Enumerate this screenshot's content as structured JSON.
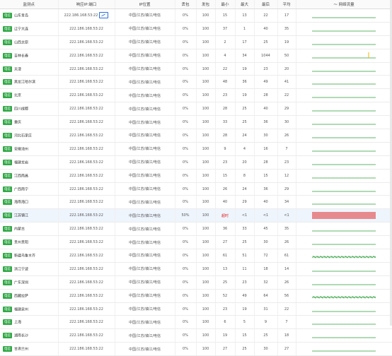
{
  "headers": {
    "node": "监测点",
    "ip": "响应IP:端口",
    "location": "IP位置",
    "loss": "丢包",
    "sent": "发包",
    "min": "最小",
    "max": "最大",
    "last": "最后",
    "avg": "平均",
    "flow": "网络流量"
  },
  "chart_data": {
    "type": "table",
    "rows": [
      {
        "tag": "电信",
        "node": "山东青岛",
        "ip": "222.186.168.53:22",
        "loc": "中国/江苏/镇江/电信",
        "loss": "0%",
        "sent": "100",
        "min": "15",
        "max": "13",
        "last": "22",
        "avg": "17",
        "spark": "flat"
      },
      {
        "tag": "电信",
        "node": "辽宁大连",
        "ip": "222.186.168.53:22",
        "loc": "中国/江苏/镇江/电信",
        "loss": "0%",
        "sent": "100",
        "min": "37",
        "max": "1",
        "last": "40",
        "avg": "35",
        "spark": "flat"
      },
      {
        "tag": "电信",
        "node": "山西太原",
        "ip": "222.186.168.53:22",
        "loc": "中国/江苏/镇江/电信",
        "loss": "0%",
        "sent": "100",
        "min": "2",
        "max": "17",
        "last": "25",
        "avg": "19",
        "spark": "flat"
      },
      {
        "tag": "电信",
        "node": "吉林长春",
        "ip": "222.186.168.53:22",
        "loc": "中国/江苏/镇江/电信",
        "loss": "0%",
        "sent": "100",
        "min": "4",
        "max": "34",
        "last": "1044",
        "avg": "50",
        "spark": "spike"
      },
      {
        "tag": "电信",
        "node": "天津",
        "ip": "222.186.168.53:22",
        "loc": "中国/江苏/镇江/电信",
        "loss": "0%",
        "sent": "100",
        "min": "22",
        "max": "19",
        "last": "23",
        "avg": "20",
        "spark": "flat"
      },
      {
        "tag": "电信",
        "node": "黑龙江哈尔滨",
        "ip": "222.186.168.53:22",
        "loc": "中国/江苏/镇江/电信",
        "loss": "0%",
        "sent": "100",
        "min": "48",
        "max": "36",
        "last": "49",
        "avg": "41",
        "spark": "flat"
      },
      {
        "tag": "电信",
        "node": "北京",
        "ip": "222.186.168.53:22",
        "loc": "中国/江苏/镇江/电信",
        "loss": "0%",
        "sent": "100",
        "min": "23",
        "max": "19",
        "last": "28",
        "avg": "22",
        "spark": "flat"
      },
      {
        "tag": "电信",
        "node": "四川成都",
        "ip": "222.186.168.53:22",
        "loc": "中国/江苏/镇江/电信",
        "loss": "0%",
        "sent": "100",
        "min": "28",
        "max": "25",
        "last": "40",
        "avg": "29",
        "spark": "flat"
      },
      {
        "tag": "电信",
        "node": "重庆",
        "ip": "222.186.168.53:22",
        "loc": "中国/江苏/镇江/电信",
        "loss": "0%",
        "sent": "100",
        "min": "33",
        "max": "25",
        "last": "36",
        "avg": "30",
        "spark": "flat"
      },
      {
        "tag": "电信",
        "node": "河北石家庄",
        "ip": "222.186.168.53:22",
        "loc": "中国/江苏/镇江/电信",
        "loss": "0%",
        "sent": "100",
        "min": "28",
        "max": "24",
        "last": "30",
        "avg": "26",
        "spark": "flat"
      },
      {
        "tag": "电信",
        "node": "安徽池州",
        "ip": "222.186.168.53:22",
        "loc": "中国/江苏/镇江/电信",
        "loss": "0%",
        "sent": "100",
        "min": "9",
        "max": "4",
        "last": "16",
        "avg": "7",
        "spark": "flat"
      },
      {
        "tag": "电信",
        "node": "福建龙岩",
        "ip": "222.186.168.53:22",
        "loc": "中国/江苏/镇江/电信",
        "loss": "0%",
        "sent": "100",
        "min": "23",
        "max": "20",
        "last": "28",
        "avg": "23",
        "spark": "flat"
      },
      {
        "tag": "电信",
        "node": "江西南昌",
        "ip": "222.186.168.53:22",
        "loc": "中国/江苏/镇江/电信",
        "loss": "0%",
        "sent": "100",
        "min": "15",
        "max": "8",
        "last": "15",
        "avg": "12",
        "spark": "flat"
      },
      {
        "tag": "电信",
        "node": "广西南宁",
        "ip": "222.186.168.53:22",
        "loc": "中国/江苏/镇江/电信",
        "loss": "0%",
        "sent": "100",
        "min": "26",
        "max": "24",
        "last": "36",
        "avg": "29",
        "spark": "flat"
      },
      {
        "tag": "电信",
        "node": "海南海口",
        "ip": "222.186.168.53:22",
        "loc": "中国/江苏/镇江/电信",
        "loss": "0%",
        "sent": "100",
        "min": "40",
        "max": "29",
        "last": "40",
        "avg": "34",
        "spark": "flat"
      },
      {
        "tag": "电信",
        "node": "江苏镇江",
        "ip": "222.186.168.53:22",
        "loc": "中国/江苏/镇江/电信",
        "loss": "50%",
        "sent": "100",
        "min": "超时",
        "max": "<1",
        "last": "<1",
        "avg": "<1",
        "spark": "loss",
        "highlight": true
      },
      {
        "tag": "电信",
        "node": "内蒙古",
        "ip": "222.186.168.53:22",
        "loc": "中国/江苏/镇江/电信",
        "loss": "0%",
        "sent": "100",
        "min": "36",
        "max": "33",
        "last": "45",
        "avg": "35",
        "spark": "flat"
      },
      {
        "tag": "电信",
        "node": "贵州贵阳",
        "ip": "222.186.168.53:22",
        "loc": "中国/江苏/镇江/电信",
        "loss": "0%",
        "sent": "100",
        "min": "27",
        "max": "25",
        "last": "30",
        "avg": "26",
        "spark": "flat"
      },
      {
        "tag": "电信",
        "node": "新疆乌鲁木齐",
        "ip": "222.186.168.53:22",
        "loc": "中国/江苏/镇江/电信",
        "loss": "0%",
        "sent": "100",
        "min": "61",
        "max": "51",
        "last": "72",
        "avg": "61",
        "spark": "noisy"
      },
      {
        "tag": "电信",
        "node": "浙江宁波",
        "ip": "222.186.168.53:22",
        "loc": "中国/江苏/镇江/电信",
        "loss": "0%",
        "sent": "100",
        "min": "13",
        "max": "11",
        "last": "18",
        "avg": "14",
        "spark": "flat"
      },
      {
        "tag": "电信",
        "node": "广东深圳",
        "ip": "222.186.168.53:22",
        "loc": "中国/江苏/镇江/电信",
        "loss": "0%",
        "sent": "100",
        "min": "25",
        "max": "23",
        "last": "32",
        "avg": "26",
        "spark": "flat"
      },
      {
        "tag": "电信",
        "node": "西藏拉萨",
        "ip": "222.186.168.53:22",
        "loc": "中国/江苏/镇江/电信",
        "loss": "0%",
        "sent": "100",
        "min": "52",
        "max": "49",
        "last": "64",
        "avg": "56",
        "spark": "noisy"
      },
      {
        "tag": "电信",
        "node": "福建泉州",
        "ip": "222.186.168.53:22",
        "loc": "中国/江苏/镇江/电信",
        "loss": "0%",
        "sent": "100",
        "min": "23",
        "max": "19",
        "last": "31",
        "avg": "22",
        "spark": "flat"
      },
      {
        "tag": "电信",
        "node": "上海",
        "ip": "222.186.168.53:22",
        "loc": "中国/江苏/镇江/电信",
        "loss": "0%",
        "sent": "100",
        "min": "6",
        "max": "5",
        "last": "9",
        "avg": "7",
        "spark": "flat"
      },
      {
        "tag": "电信",
        "node": "湖南长沙",
        "ip": "222.186.168.53:22",
        "loc": "中国/江苏/镇江/电信",
        "loss": "0%",
        "sent": "100",
        "min": "19",
        "max": "15",
        "last": "25",
        "avg": "18",
        "spark": "flat"
      },
      {
        "tag": "电信",
        "node": "甘肃兰州",
        "ip": "222.186.168.53:22",
        "loc": "中国/江苏/镇江/电信",
        "loss": "0%",
        "sent": "100",
        "min": "27",
        "max": "25",
        "last": "30",
        "avg": "27",
        "spark": "flat"
      }
    ]
  },
  "colors": {
    "tag": "#31a846",
    "spark_ok": "#2e9e3a",
    "spark_loss": "#e02020",
    "spark_spike": "#f0b400"
  }
}
